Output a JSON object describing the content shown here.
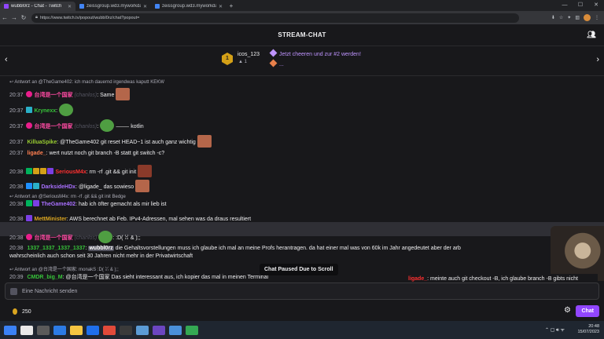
{
  "browser": {
    "tabs": [
      {
        "title": "wubbl0rz - Chat - Twitch",
        "active": true
      },
      {
        "title": "zeissgroup.wd3.myworkdayjobs.c",
        "active": false
      },
      {
        "title": "zeissgroup.wd3.myworkdayjobs.c",
        "active": false
      }
    ],
    "new_tab": "+",
    "url": "https://www.twitch.tv/popout/wubbl0rz/chat?popout="
  },
  "header": {
    "title": "STREAM-CHAT"
  },
  "leaderboard": {
    "rank": "1",
    "name": "icos_123",
    "score": "1",
    "cta_line1": "Jetzt cheeren und zur #2 werden!",
    "cta_line2": "..."
  },
  "chat": {
    "top_reply": "Antwort an @TheGame402: ich mach dauernd irgendwas kaputt KEKW",
    "messages": [
      {
        "ts": "20:37",
        "user": "台湾是一个国家",
        "sub": "(chanlos)",
        "text": ": Same"
      },
      {
        "ts": "20:37",
        "user": "Krynexx",
        "text": ":"
      },
      {
        "ts": "20:37",
        "user": "台湾是一个国家",
        "sub": "(chanlos)",
        "text": ":",
        "text2": "kotlin"
      },
      {
        "ts": "20:37",
        "user": "KilluaSpike",
        "text": ": @TheGame402 git reset HEAD~1 ist auch ganz wichtig"
      },
      {
        "ts": "20:37",
        "user": "ligade_",
        "text": ": wert nutzt noch git branch -B statt git switch -c?"
      },
      {
        "ts": "20:38",
        "user": "SeriousM4x",
        "text": ": rm -rf .git && git init"
      },
      {
        "ts": "20:38",
        "user": "DarksideHDx",
        "text": ": @ligade_ das sowieso"
      },
      {
        "ts": "20:38",
        "user": "TheGame402",
        "text": ": hab ich öfter gemacht als mir lieb ist"
      },
      {
        "ts": "20:38",
        "user": "MettMinister",
        "text": ": AWS berechnet ab Feb. IPv4-Adressen, mal sehen was da draus resultiert"
      },
      {
        "ts": "20:38",
        "user": "台湾是一个国家",
        "sub": "(chanlos)",
        "text": ": :D( ꈍ & );;"
      },
      {
        "ts": "20:38",
        "user": "1337_1337_1337_1337",
        "mention": "wubbl0rz",
        "text": " die Gehaltsvorstellungen muss ich glaube ich mal an meine Profs herantragen. da hat einer mal was von 60k im Jahr angedeutet aber der arb",
        "text2": "wahrscheinlich auch schon seit 30 Jahren nicht mehr in der Privatwirtschaft"
      },
      {
        "ts": "20:39",
        "user": "CMDR_big_M",
        "text": ": @台湾是一个国家 Das sieht interessant aus, ich kopier das mal in meinen Terminal"
      }
    ],
    "replies": [
      "Antwort an @SeriousM4x: rm -rf .git && git init Bedge",
      "Antwort an @台湾是一个国家: monakS :D( ꈍ & );;"
    ],
    "floating": {
      "user": "ligade_",
      "text": ": meinte auch git checkout -B, ich glaube branch -B gibts nicht"
    },
    "paused_label": "Chat Paused Due to Scroll"
  },
  "compose": {
    "placeholder": "Eine Nachricht senden"
  },
  "footer": {
    "points": "250",
    "chat_button": "Chat"
  },
  "taskbar": {
    "time": "20:48",
    "date": "15/07/2023"
  },
  "colors": {
    "twitch_purple": "#9146ff",
    "background": "#18181b"
  },
  "icons": [
    "users-icon",
    "chevron-left-icon",
    "chevron-right-icon",
    "gear-icon",
    "channel-points-icon",
    "reload-icon",
    "back-icon",
    "forward-icon"
  ]
}
